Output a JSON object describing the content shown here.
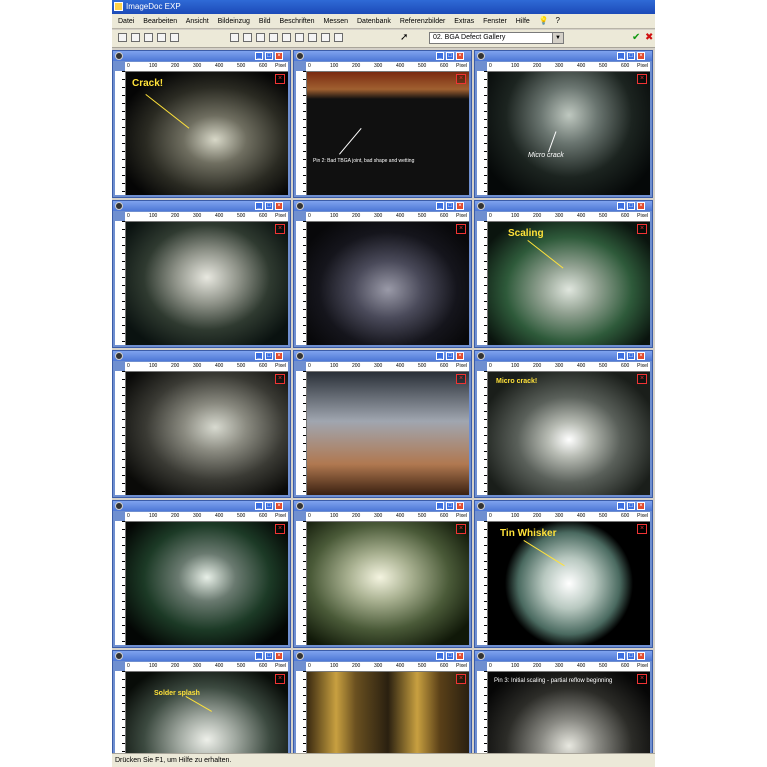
{
  "app": {
    "title": "ImageDoc EXP",
    "menu": [
      "Datei",
      "Bearbeiten",
      "Ansicht",
      "Bildeinzug",
      "Bild",
      "Beschriften",
      "Messen",
      "Datenbank",
      "Referenzbilder",
      "Extras",
      "Fenster",
      "Hilfe"
    ],
    "gallery_selected": "02. BGA Defect Gallery",
    "status": "Drücken Sie F1, um Hilfe zu erhalten."
  },
  "ruler": {
    "ticks": [
      "0",
      "100",
      "200",
      "300",
      "400",
      "500",
      "600"
    ],
    "unit": "Pixel"
  },
  "windows": [
    {
      "caption": "Crack!",
      "style": "yellow-big"
    },
    {
      "caption": "Pin 2: Bad TBGA joint, bad shape and wetting",
      "style": "white-small"
    },
    {
      "caption": "Micro crack",
      "style": "white-italic"
    },
    {
      "caption": "",
      "style": ""
    },
    {
      "caption": "",
      "style": ""
    },
    {
      "caption": "Scaling",
      "style": "yellow-big"
    },
    {
      "caption": "",
      "style": ""
    },
    {
      "caption": "",
      "style": ""
    },
    {
      "caption": "Micro crack!",
      "style": "yellow-small"
    },
    {
      "caption": "",
      "style": ""
    },
    {
      "caption": "",
      "style": ""
    },
    {
      "caption": "Tin Whisker",
      "style": "yellow-big"
    },
    {
      "caption": "Solder splash",
      "style": "yellow-small"
    },
    {
      "caption": "",
      "style": ""
    },
    {
      "caption": "Pin 3: Initial scaling - partial reflow beginning",
      "style": "white-small"
    }
  ],
  "colors": {
    "titlebar": "#1c4ab8",
    "window_frame": "#6f8fd0",
    "caption_yellow": "#ffe23a",
    "close_red": "#e14a2b"
  }
}
